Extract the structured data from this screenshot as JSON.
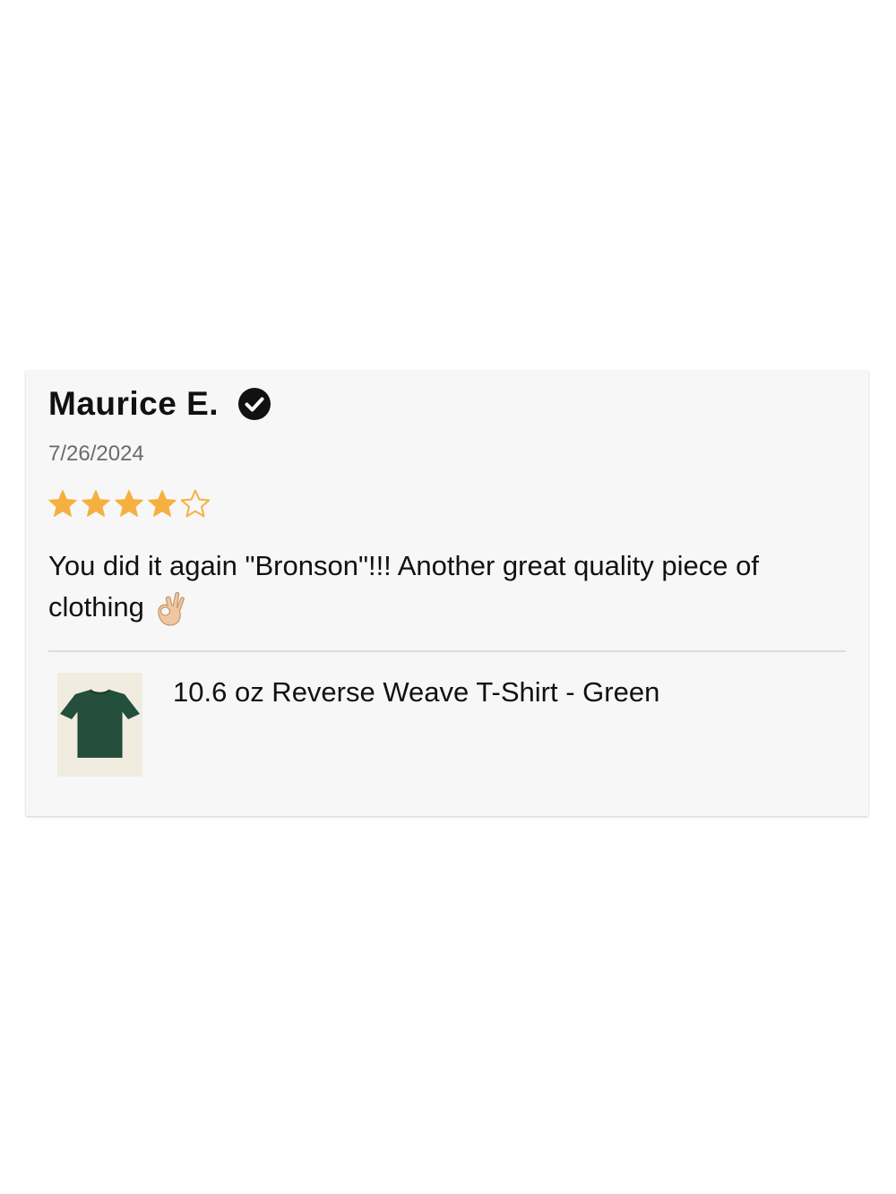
{
  "review": {
    "reviewer_name": "Maurice E.",
    "verified_icon": "verified-check-icon",
    "date": "7/26/2024",
    "rating": 4,
    "rating_max": 5,
    "star_color": "#f5b041",
    "body_text": "You did it again \"Bronson\"!!! Another great quality piece of clothing",
    "body_emoji": "ok-hand-emoji",
    "product": {
      "name": "10.6 oz Reverse Weave T-Shirt - Green",
      "thumbnail_icon": "green-tshirt-image",
      "color": "#234f3c"
    }
  }
}
